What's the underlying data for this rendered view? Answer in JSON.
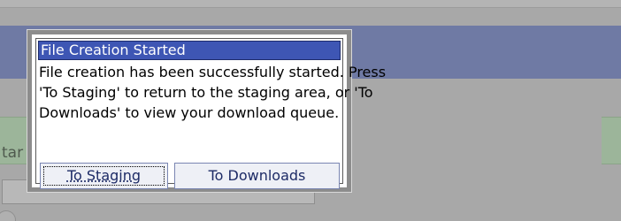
{
  "dialog": {
    "title": "File Creation Started",
    "message_lines": [
      "File creation has been successfully started. Press",
      "'To Staging' to return to the staging area, or 'To",
      "Downloads' to view your download queue."
    ],
    "buttons": {
      "to_staging": "To Staging",
      "to_downloads": "To Downloads"
    }
  },
  "background": {
    "status_text_fragment": "tar"
  },
  "colors": {
    "title_bar": "#3e56b4",
    "overlay": "#a8a8a8",
    "header_band": "#6f7aa4",
    "status_panel": "#9cb59a"
  }
}
